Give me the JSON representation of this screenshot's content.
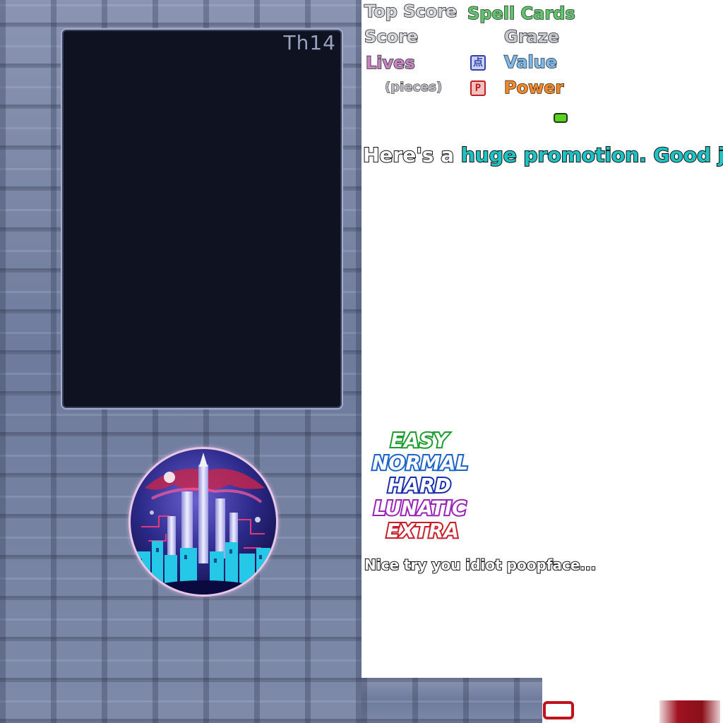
{
  "card": {
    "game_label": "Th14"
  },
  "hud": {
    "top_score": "Top Score",
    "score": "Score",
    "lives": "Lives",
    "pieces": "(pieces)",
    "spell_cards": "Spell Cards",
    "graze": "Graze",
    "value": "Value",
    "power": "Power",
    "point_item_glyph": "点",
    "power_item_glyph": "P",
    "point_item_icon": "point-item-icon",
    "power_item_icon": "power-item-icon"
  },
  "promotion": {
    "prefix": "Here's a ",
    "highlight": "huge promotion. Good job!"
  },
  "difficulties": {
    "easy": "EASY",
    "normal": "NORMAL",
    "hard": "HARD",
    "lunatic": "LUNATIC",
    "extra": "EXTRA"
  },
  "taunt": "Nice try you idiot poopface...",
  "colors": {
    "lives": "#c883c4",
    "spell_cards": "#63c26f",
    "value": "#7fb8e6",
    "power": "#ee8a2e",
    "promotion_highlight": "#1fc2c2",
    "easy": "#1e9b2e",
    "normal": "#1b63c8",
    "hard": "#1a2fb0",
    "lunatic": "#9a24b8",
    "extra": "#c81e2a"
  }
}
